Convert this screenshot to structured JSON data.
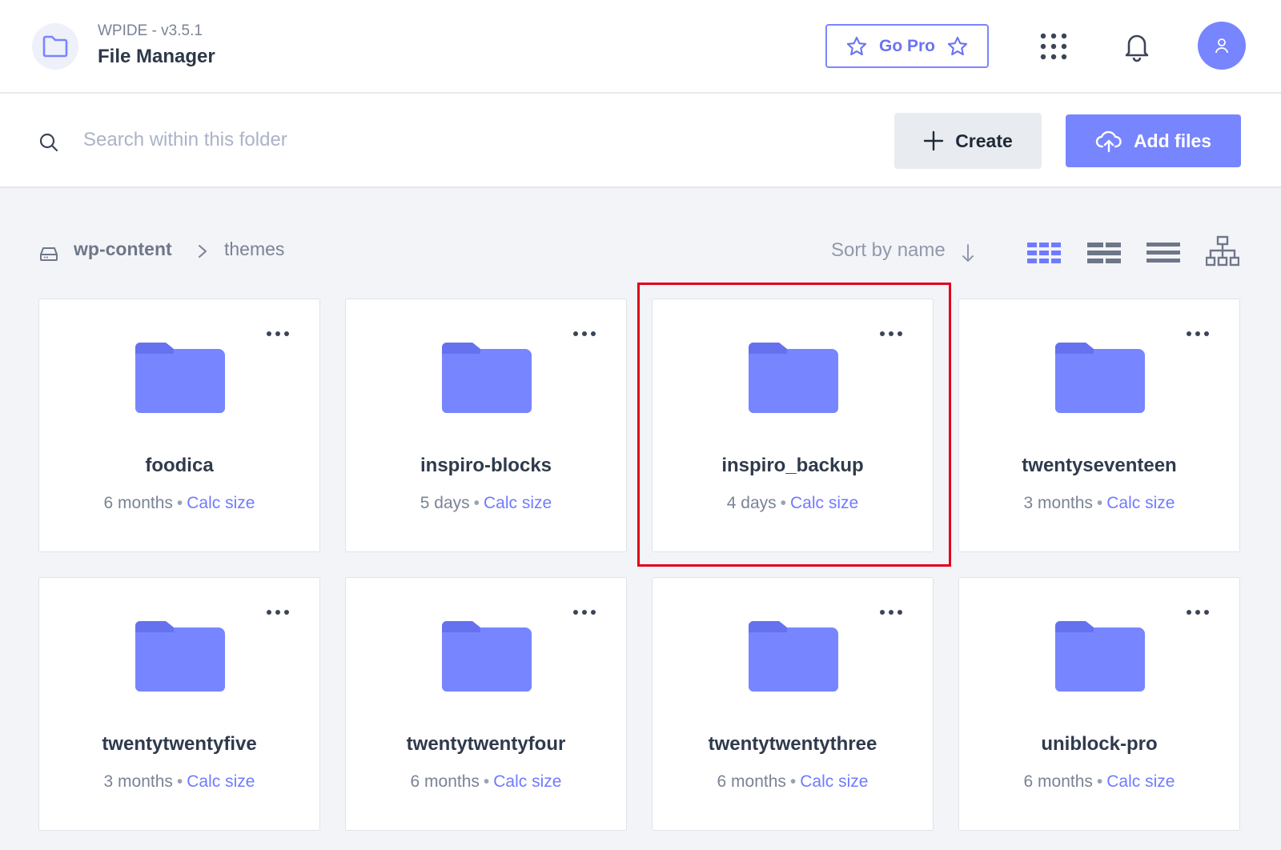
{
  "header": {
    "app_version": "WPIDE - v3.5.1",
    "app_title": "File Manager",
    "go_pro_label": "Go Pro",
    "accent_color": "#7785ff"
  },
  "toolbar": {
    "search_placeholder": "Search within this folder",
    "create_label": "Create",
    "add_files_label": "Add files"
  },
  "breadcrumb": {
    "items": [
      "wp-content",
      "themes"
    ]
  },
  "sort": {
    "label": "Sort by name"
  },
  "folders": [
    {
      "name": "foodica",
      "modified": "6 months",
      "calc_label": "Calc size"
    },
    {
      "name": "inspiro-blocks",
      "modified": "5 days",
      "calc_label": "Calc size"
    },
    {
      "name": "inspiro_backup",
      "modified": "4 days",
      "calc_label": "Calc size"
    },
    {
      "name": "twentyseventeen",
      "modified": "3 months",
      "calc_label": "Calc size"
    },
    {
      "name": "twentytwentyfive",
      "modified": "3 months",
      "calc_label": "Calc size"
    },
    {
      "name": "twentytwentyfour",
      "modified": "6 months",
      "calc_label": "Calc size"
    },
    {
      "name": "twentytwentythree",
      "modified": "6 months",
      "calc_label": "Calc size"
    },
    {
      "name": "uniblock-pro",
      "modified": "6 months",
      "calc_label": "Calc size"
    }
  ]
}
